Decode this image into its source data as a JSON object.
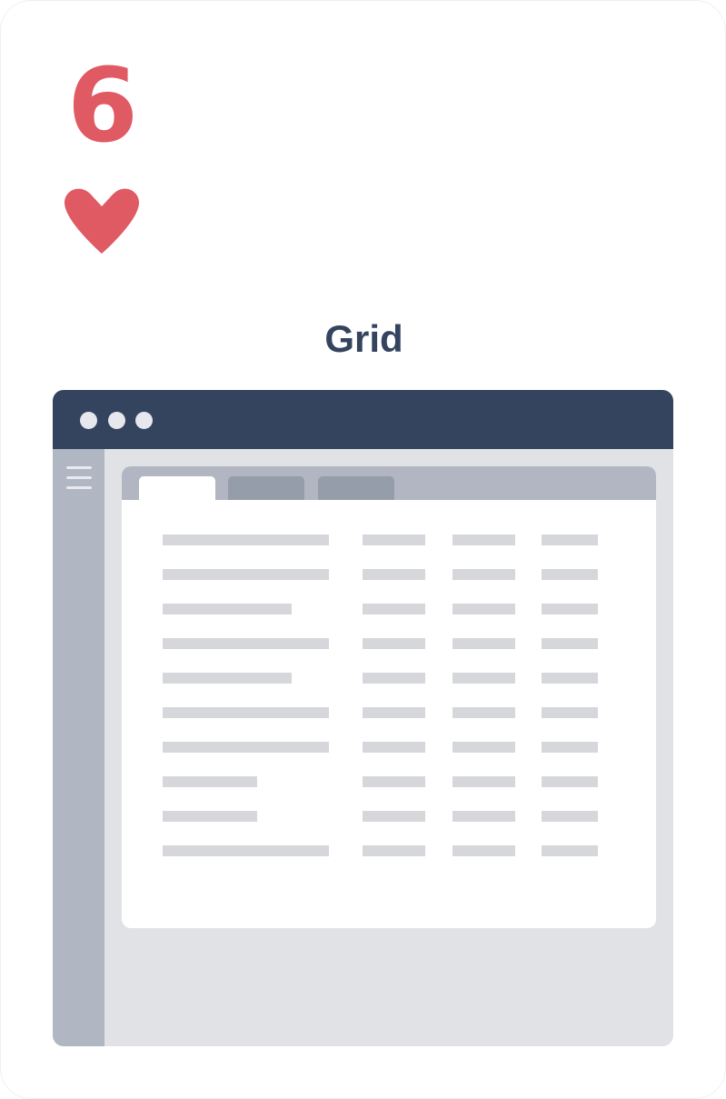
{
  "card": {
    "rank": "6",
    "suit_icon": "heart-icon",
    "title": "Grid"
  },
  "colors": {
    "suit_red": "#e05a64",
    "navy": "#34445f",
    "sidebar": "#b0b6c2",
    "placeholder": "#d6d7db",
    "window_bg": "#e1e2e6"
  },
  "window": {
    "titlebar_dots": 3,
    "menu_icon": "hamburger-menu-icon",
    "tabs": [
      {
        "state": "active"
      },
      {
        "state": "inactive"
      },
      {
        "state": "inactive"
      }
    ],
    "rows": [
      {
        "first_cell": "long"
      },
      {
        "first_cell": "long"
      },
      {
        "first_cell": "medium"
      },
      {
        "first_cell": "long"
      },
      {
        "first_cell": "medium"
      },
      {
        "first_cell": "long"
      },
      {
        "first_cell": "long"
      },
      {
        "first_cell": "short"
      },
      {
        "first_cell": "short"
      },
      {
        "first_cell": "long"
      }
    ]
  }
}
